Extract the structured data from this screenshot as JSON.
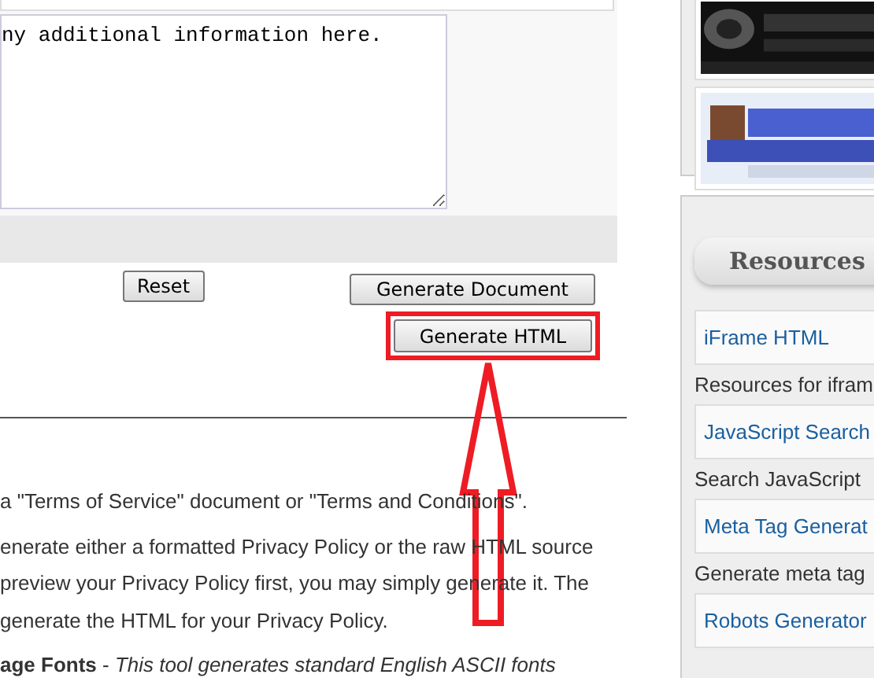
{
  "form": {
    "notes_value": "ny additional information here.",
    "buttons": [
      {
        "label": "Reset",
        "kind": "reset"
      },
      {
        "label": "Generate Document",
        "kind": "document"
      },
      {
        "label": "Generate HTML",
        "kind": "html",
        "highlighted": true
      }
    ]
  },
  "content": {
    "paragraphs": [
      "a \"Terms of Service\" document or \"Terms and Conditions\".",
      "enerate either a formatted Privacy Policy or the raw HTML source",
      "preview your Privacy Policy first, you may simply generate it. The",
      "generate the HTML for your Privacy Policy.",
      "**age Fonts** - *This tool generates standard English ASCII fonts*"
    ]
  },
  "sidebar": {
    "resources": {
      "title": "Resources",
      "items": [
        {
          "link": "iFrame HTML",
          "description": "Resources for ifram"
        },
        {
          "link": "JavaScript Search",
          "description": "Search JavaScript"
        },
        {
          "link": "Meta Tag Generat",
          "description": "Generate meta tag"
        },
        {
          "link": "Robots Generator"
        }
      ]
    }
  }
}
